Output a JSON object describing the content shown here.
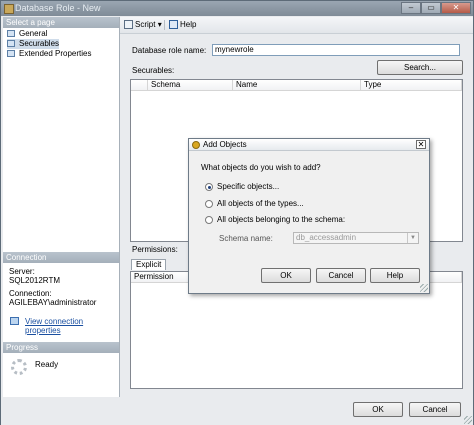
{
  "window": {
    "title": "Database Role - New",
    "minimize": "–",
    "restore": "▭",
    "close": "✕"
  },
  "left": {
    "select_page_header": "Select a page",
    "pages": [
      "General",
      "Securables",
      "Extended Properties"
    ],
    "connection_header": "Connection",
    "server_label": "Server:",
    "server_value": "SQL2012RTM",
    "connection_label": "Connection:",
    "connection_value": "AGILEBAY\\administrator",
    "view_connection_link": "View connection properties",
    "progress_header": "Progress",
    "progress_status": "Ready"
  },
  "toolbar": {
    "script_label": "Script",
    "script_arrow": "▾",
    "help_label": "Help"
  },
  "main": {
    "role_name_label": "Database role name:",
    "role_name_value": "mynewrole",
    "securables_label": "Securables:",
    "search_button": "Search...",
    "columns": [
      "Schema",
      "Name",
      "Type"
    ],
    "permissions_label": "Permissions:",
    "tab_explicit": "Explicit",
    "perm_columns": [
      "Permission"
    ]
  },
  "footer": {
    "ok": "OK",
    "cancel": "Cancel"
  },
  "dialog": {
    "title": "Add Objects",
    "close": "✕",
    "question": "What objects do you wish to add?",
    "options": [
      "Specific objects...",
      "All objects of the types...",
      "All objects belonging to the schema:"
    ],
    "selected_index": 0,
    "schema_label": "Schema name:",
    "schema_value": "db_accessadmin",
    "ok": "OK",
    "cancel": "Cancel",
    "help": "Help"
  }
}
